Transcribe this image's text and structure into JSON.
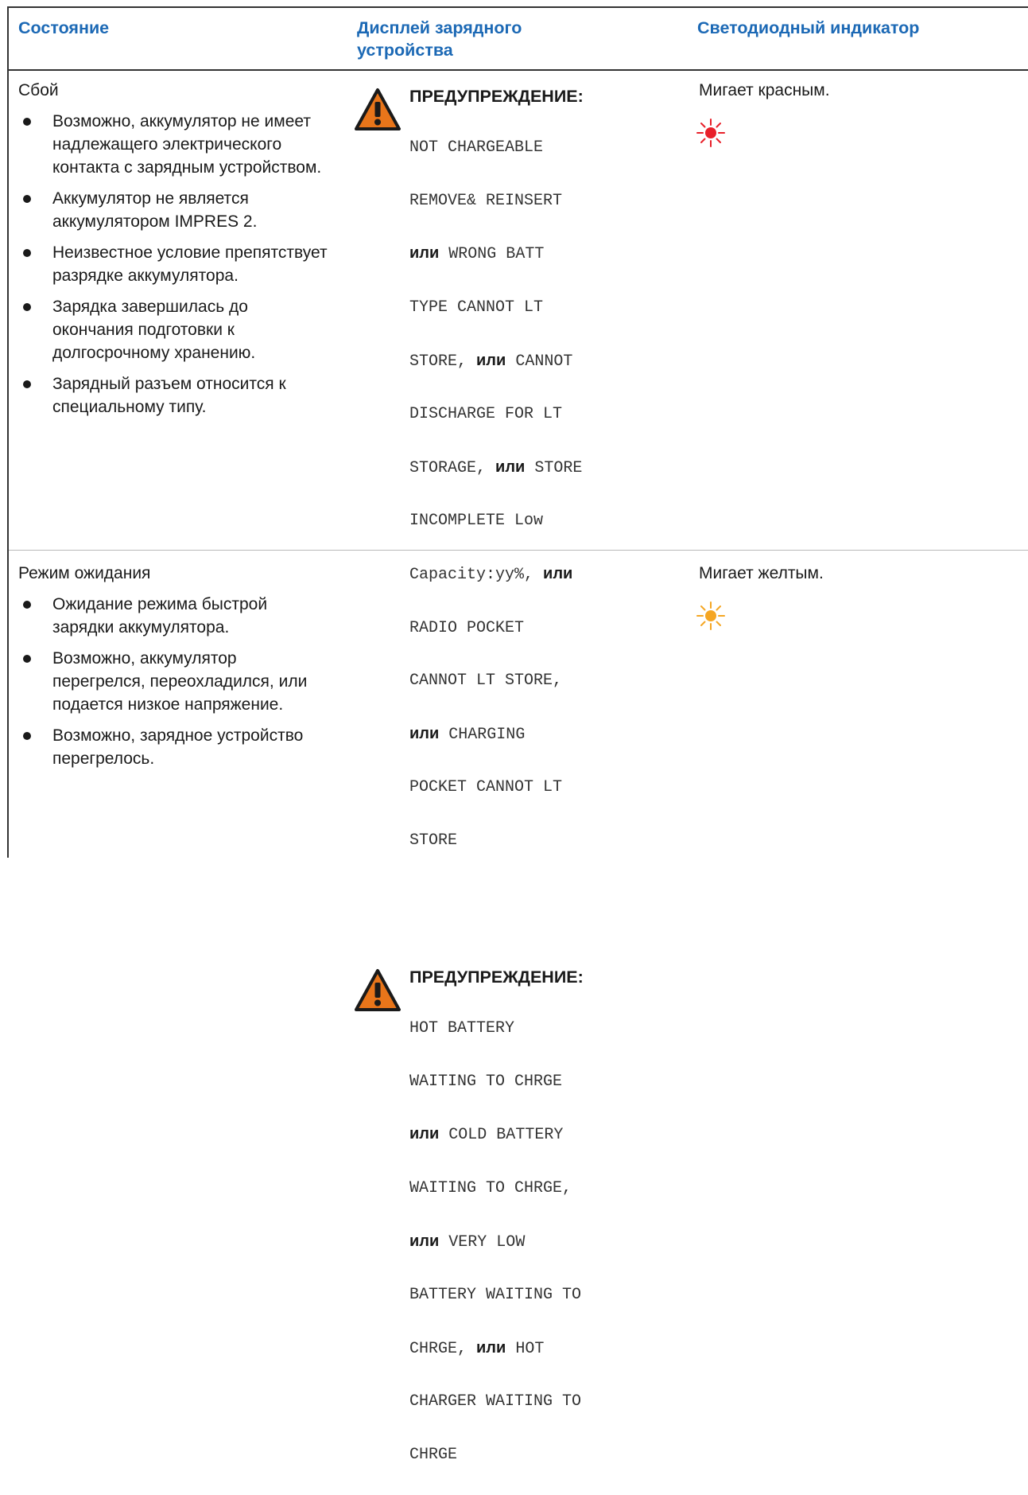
{
  "header": {
    "col1": "Состояние",
    "col2": "Дисплей зарядного устройства",
    "col3": "Светодиодный индикатор"
  },
  "rows": [
    {
      "status": "Сбой",
      "bullets": [
        "Возможно, аккумулятор не имеет надлежащего электрического контакта с зарядным устройством.",
        "Аккумулятор не является аккумулятором IMPRES 2.",
        "Неизвестное условие препятствует разрядке аккумулятора.",
        "Зарядка завершилась до окончания подготовки к долгосрочному хранению.",
        "Зарядный разъем относится к специальному типу."
      ],
      "warning_label": "ПРЕДУПРЕЖДЕНИЕ:",
      "display_lines": [
        "NOT CHARGEABLE",
        "REMOVE& REINSERT",
        "или WRONG BATT",
        "TYPE CANNOT LT",
        "STORE, или CANNOT",
        "DISCHARGE FOR LT",
        "STORAGE, или STORE",
        "INCOMPLETE Low",
        "Capacity:yy%, или",
        "RADIO POCKET",
        "CANNOT LT STORE,",
        "или CHARGING",
        "POCKET CANNOT LT",
        "STORE"
      ],
      "led_text": "Мигает красным.",
      "led_color": "#e8202a",
      "led_icon": "blinking-red-led-icon"
    },
    {
      "status": "Режим ожидания",
      "bullets": [
        "Ожидание режима быстрой зарядки аккумулятора.",
        "Возможно, аккумулятор перегрелся, переохладился, или подается низкое напряжение.",
        "Возможно, зарядное устройство перегрелось."
      ],
      "warning_label": "ПРЕДУПРЕЖДЕНИЕ:",
      "display_lines": [
        "HOT BATTERY",
        "WAITING TO CHRGE",
        "или COLD BATTERY",
        "WAITING TO CHRGE,",
        "или VERY LOW",
        "BATTERY WAITING TO",
        "CHRGE, или HOT",
        "CHARGER WAITING TO",
        "CHRGE"
      ],
      "led_text": "Мигает желтым.",
      "led_color": "#f5a623",
      "led_icon": "blinking-yellow-led-icon"
    }
  ],
  "colors": {
    "header_text": "#1c69b5",
    "warning_fill": "#e8751a"
  }
}
